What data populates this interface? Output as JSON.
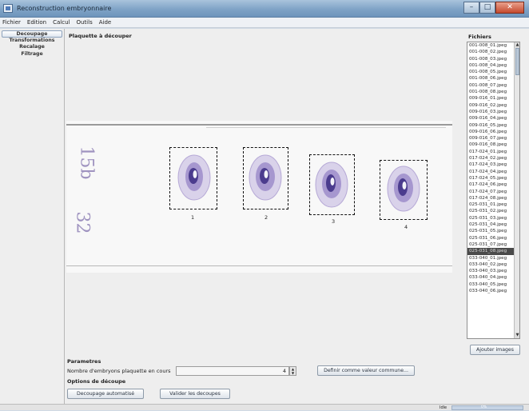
{
  "window": {
    "title": "Reconstruction embryonnaire",
    "buttons": {
      "minimize": "–",
      "maximize": "□",
      "close": "✕"
    }
  },
  "menu": [
    "Fichier",
    "Edition",
    "Calcul",
    "Outils",
    "Aide"
  ],
  "sidebar": {
    "tabs": [
      {
        "label": "Decoupage",
        "active": true
      },
      {
        "label": "Transformations",
        "active": false
      },
      {
        "label": "Recalage",
        "active": false
      },
      {
        "label": "Filtrage",
        "active": false
      }
    ]
  },
  "plate": {
    "title": "Plaquette à découper",
    "handwriting": [
      "15b",
      "32"
    ],
    "crops": [
      "1",
      "2",
      "3",
      "4"
    ]
  },
  "files": {
    "title": "Fichiers",
    "items": [
      "001-008_01.jpeg",
      "001-008_02.jpeg",
      "001-008_03.jpeg",
      "001-008_04.jpeg",
      "001-008_05.jpeg",
      "001-008_06.jpeg",
      "001-008_07.jpeg",
      "001-008_08.jpeg",
      "009-016_01.jpeg",
      "009-016_02.jpeg",
      "009-016_03.jpeg",
      "009-016_04.jpeg",
      "009-016_05.jpeg",
      "009-016_06.jpeg",
      "009-016_07.jpeg",
      "009-016_08.jpeg",
      "017-024_01.jpeg",
      "017-024_02.jpeg",
      "017-024_03.jpeg",
      "017-024_04.jpeg",
      "017-024_05.jpeg",
      "017-024_06.jpeg",
      "017-024_07.jpeg",
      "017-024_08.jpeg",
      "025-031_01.jpeg",
      "025-031_02.jpeg",
      "025-031_03.jpeg",
      "025-031_04.jpeg",
      "025-031_05.jpeg",
      "025-031_06.jpeg",
      "025-031_07.jpeg",
      "025-031_08.jpeg",
      "033-040_01.jpeg",
      "033-040_02.jpeg",
      "033-040_03.jpeg",
      "033-040_04.jpeg",
      "033-040_05.jpeg",
      "033-040_06.jpeg"
    ],
    "selected_index": 31,
    "add_button": "Ajouter images"
  },
  "params": {
    "title": "Parametres",
    "embryos_label": "Nombre d'embryons plaquette en cours",
    "embryos_value": "4",
    "default_button": "Definir comme valeur commune..."
  },
  "options": {
    "title": "Options de découpe",
    "auto_button": "Decoupage automatisé",
    "validate_button": "Valider les decoupes"
  },
  "status": {
    "text": "Idle",
    "progress": "0%"
  }
}
